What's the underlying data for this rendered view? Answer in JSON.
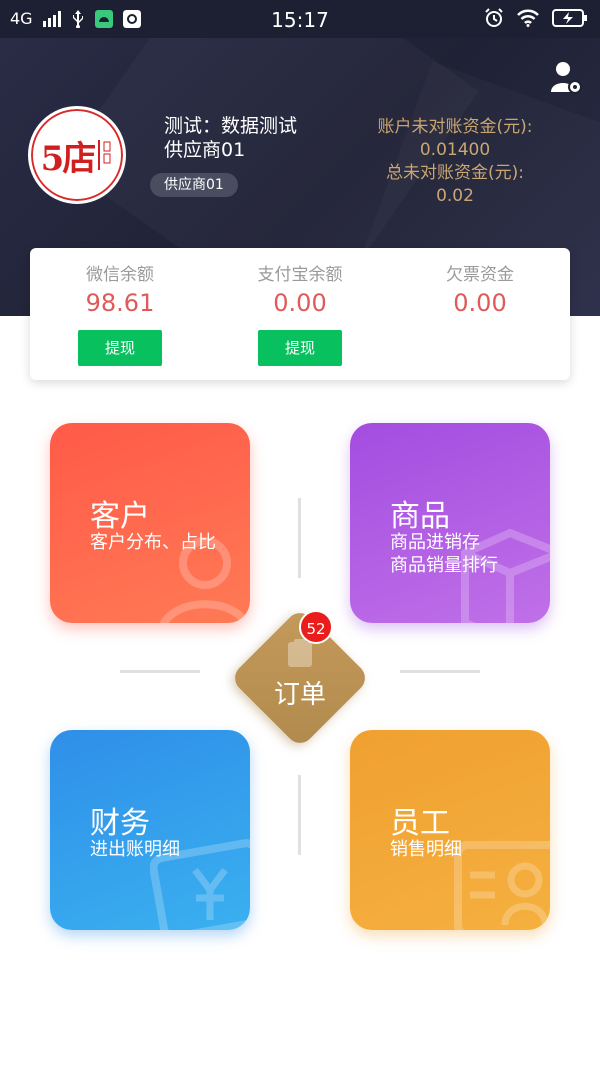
{
  "status_bar": {
    "network": "4G",
    "time": "15:17"
  },
  "header": {
    "logo_text": "5店",
    "shop_line1": "测试：数据测试",
    "shop_line2": "供应商01",
    "supplier_tag": "供应商01",
    "unreconciled_label": "账户未对账资金(元):",
    "unreconciled_value": "0.01400",
    "total_unreconciled_label": "总未对账资金(元):",
    "total_unreconciled_value": "0.02"
  },
  "balances": [
    {
      "label": "微信余额",
      "value": "98.61",
      "button": "提现"
    },
    {
      "label": "支付宝余额",
      "value": "0.00",
      "button": "提现"
    },
    {
      "label": "欠票资金",
      "value": "0.00"
    }
  ],
  "tiles": {
    "customer": {
      "title": "客户",
      "sub1": "客户分布、占比"
    },
    "goods": {
      "title": "商品",
      "sub1": "商品进销存",
      "sub2": "商品销量排行"
    },
    "finance": {
      "title": "财务",
      "sub1": "进出账明细"
    },
    "staff": {
      "title": "员工",
      "sub1": "销售明细"
    }
  },
  "order": {
    "label": "订单",
    "badge": "52"
  },
  "colors": {
    "header_bg": "#1f2135",
    "gold": "#c9a46e",
    "value_red": "#e05a5a",
    "withdraw_green": "#09c05f",
    "customer": "#ff5a48",
    "goods": "#a34de0",
    "finance": "#2f8fe8",
    "staff": "#f0a030",
    "order": "#b8905a",
    "badge": "#ea1c1c"
  }
}
